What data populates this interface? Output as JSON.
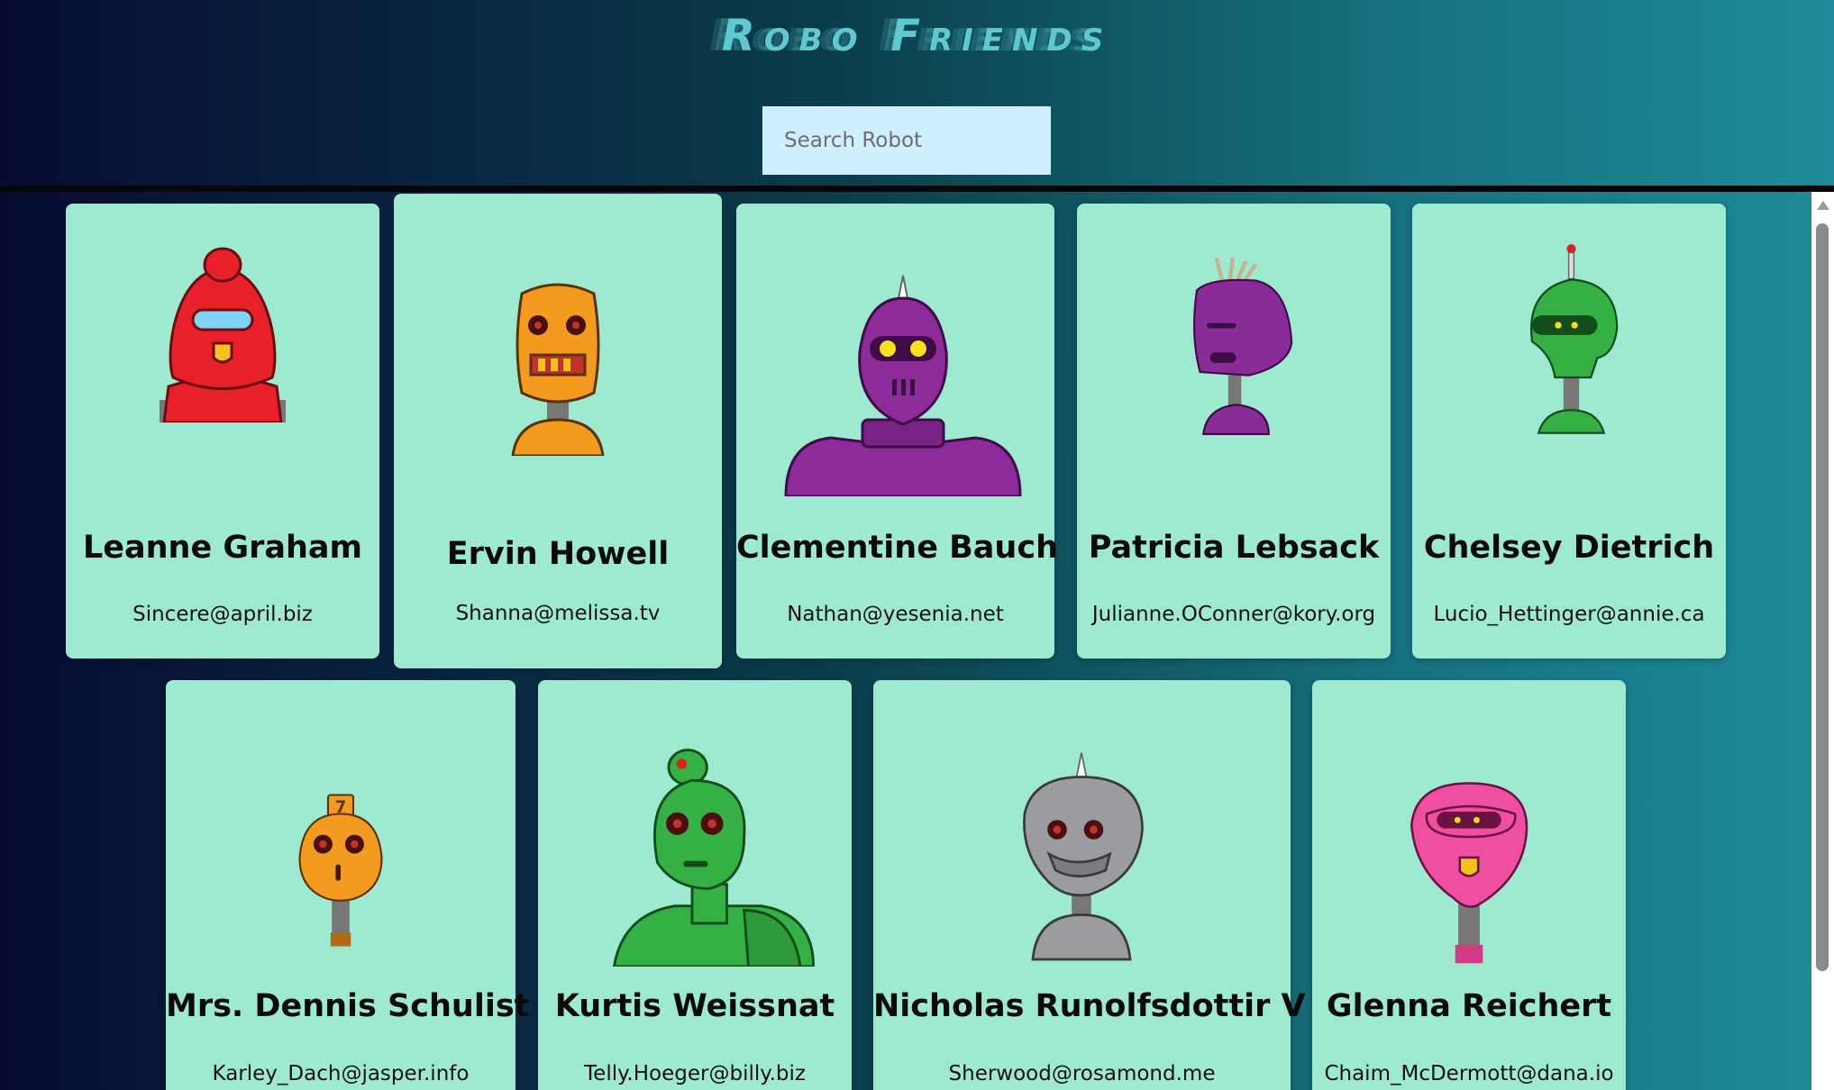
{
  "app": {
    "title": "Robo Friends",
    "search_placeholder": "Search Robot"
  },
  "robots": [
    {
      "name": "Leanne Graham",
      "email": "Sincere@april.biz",
      "color": "#e8202a",
      "icon": "red-robot-icon"
    },
    {
      "name": "Ervin Howell",
      "email": "Shanna@melissa.tv",
      "color": "#f39a1f",
      "icon": "orange-robot-icon"
    },
    {
      "name": "Clementine Bauch",
      "email": "Nathan@yesenia.net",
      "color": "#8e2b9a",
      "icon": "purple-robot-icon"
    },
    {
      "name": "Patricia Lebsack",
      "email": "Julianne.OConner@kory.org",
      "color": "#8a2c97",
      "icon": "purple-robot-icon"
    },
    {
      "name": "Chelsey Dietrich",
      "email": "Lucio_Hettinger@annie.ca",
      "color": "#35b045",
      "icon": "green-robot-icon"
    },
    {
      "name": "Mrs. Dennis Schulist",
      "email": "Karley_Dach@jasper.info",
      "color": "#f39a1f",
      "icon": "orange-robot-icon"
    },
    {
      "name": "Kurtis Weissnat",
      "email": "Telly.Hoeger@billy.biz",
      "color": "#35b045",
      "icon": "green-robot-icon"
    },
    {
      "name": "Nicholas Runolfsdottir V",
      "email": "Sherwood@rosamond.me",
      "color": "#9a9ca0",
      "icon": "gray-robot-icon"
    },
    {
      "name": "Glenna Reichert",
      "email": "Chaim_McDermott@dana.io",
      "color": "#ee4fa0",
      "icon": "pink-robot-icon"
    }
  ],
  "colors": {
    "card_bg": "#9eead1",
    "search_bg": "#cfeefe",
    "title": "#5fc9d2"
  }
}
